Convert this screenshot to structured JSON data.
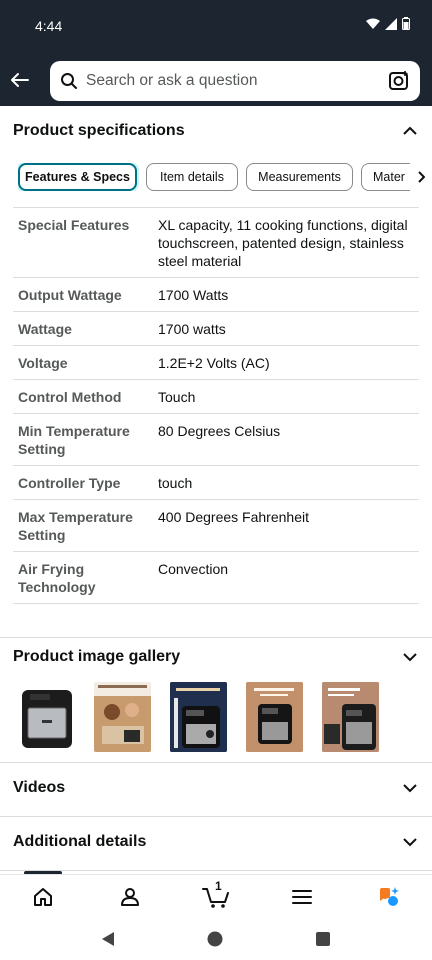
{
  "status_bar": {
    "time": "4:44"
  },
  "search": {
    "placeholder": "Search or ask a question"
  },
  "product_specs": {
    "title": "Product specifications",
    "tabs": [
      {
        "label": "Features & Specs",
        "active": true
      },
      {
        "label": "Item details",
        "active": false
      },
      {
        "label": "Measurements",
        "active": false
      },
      {
        "label": "Mater",
        "active": false
      }
    ],
    "rows": [
      {
        "label": "Special Features",
        "value": "XL capacity, 11 cooking functions, digital touchscreen, patented design, stainless steel material"
      },
      {
        "label": "Output Wattage",
        "value": "1700 Watts"
      },
      {
        "label": "Wattage",
        "value": "1700 watts"
      },
      {
        "label": "Voltage",
        "value": "1.2E+2 Volts (AC)"
      },
      {
        "label": "Control Method",
        "value": "Touch"
      },
      {
        "label": "Min Temperature Setting",
        "value": "80 Degrees Celsius"
      },
      {
        "label": "Controller Type",
        "value": "touch"
      },
      {
        "label": "Max Temperature Setting",
        "value": "400 Degrees Fahrenheit"
      },
      {
        "label": "Air Frying Technology",
        "value": "Convection"
      }
    ]
  },
  "gallery": {
    "title": "Product image gallery",
    "thumb_count": 5
  },
  "videos": {
    "title": "Videos"
  },
  "additional": {
    "title": "Additional details"
  },
  "bottom_nav": {
    "cart_count": "1"
  },
  "colors": {
    "accent": "#007185",
    "header_bg": "#1d2530",
    "text": "#0f1111",
    "muted": "#565959"
  }
}
